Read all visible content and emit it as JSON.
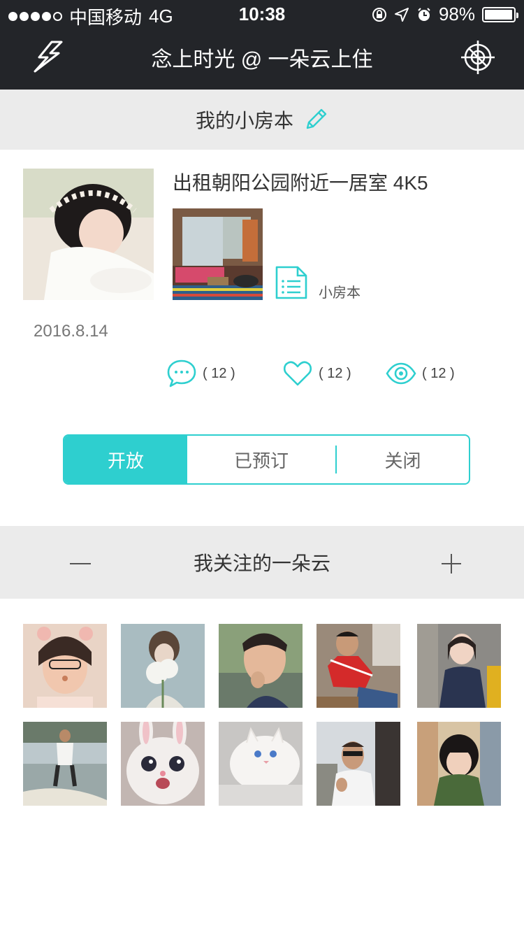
{
  "status_bar": {
    "carrier": "中国移动",
    "network": "4G",
    "time": "10:38",
    "battery": "98%",
    "battery_level": 0.98
  },
  "nav": {
    "title": "念上时光 @ 一朵云上住",
    "left_icon": "lightning-icon",
    "right_icon": "crosshair-icon"
  },
  "section_room": {
    "title": "我的小房本",
    "icon": "pencil-icon"
  },
  "post": {
    "title": "出租朝阳公园附近一居室  4K5",
    "doc_label": "小房本",
    "date": "2016.8.14",
    "comments": "( 12 )",
    "likes": "( 12 )",
    "views": "( 12 )"
  },
  "segment": {
    "options": [
      "开放",
      "已预订",
      "关闭"
    ],
    "selected": "开放"
  },
  "section_follow": {
    "title": "我关注的一朵云"
  },
  "colors": {
    "accent": "#2ecfcf",
    "nav_bg": "#232529",
    "section_bg": "#ebebeb"
  }
}
